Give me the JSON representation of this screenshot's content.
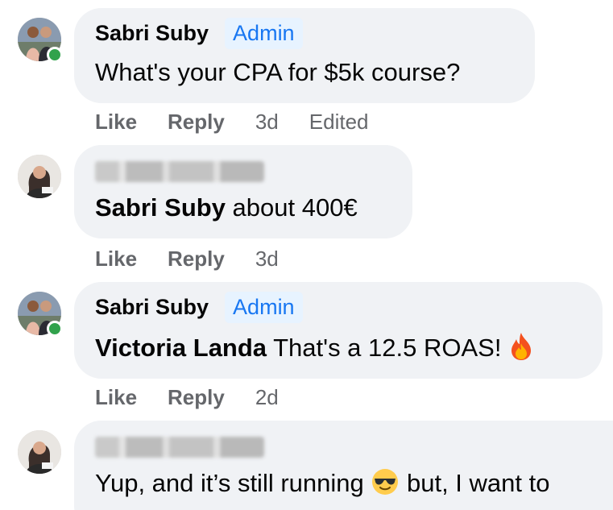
{
  "comments": [
    {
      "author": "Sabri Suby",
      "badge": "Admin",
      "text": "What's your CPA for $5k course?",
      "like": "Like",
      "reply": "Reply",
      "time": "3d",
      "edited": "Edited"
    },
    {
      "author_hidden": true,
      "mention": "Sabri Suby",
      "text": " about 400€",
      "like": "Like",
      "reply": "Reply",
      "time": "3d"
    },
    {
      "author": "Sabri Suby",
      "badge": "Admin",
      "mention": "Victoria Landa",
      "text": " That's a 12.5 ROAS!",
      "emoji": "fire-emoji",
      "like": "Like",
      "reply": "Reply",
      "time": "2d"
    },
    {
      "author_hidden": true,
      "text_before": "Yup, and it’s still running ",
      "emoji": "sunglasses-emoji",
      "text_after": " but, I want to"
    }
  ],
  "colors": {
    "bubble": "#f0f2f5",
    "badge_bg": "#e7f3ff",
    "badge_text": "#1877f2",
    "action_text": "#65676b",
    "online": "#31a24c"
  }
}
